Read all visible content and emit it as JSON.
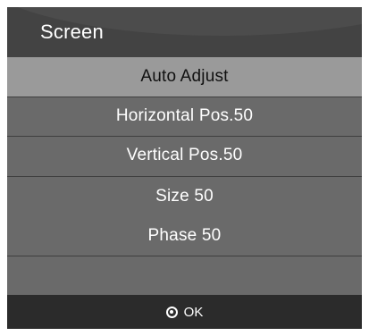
{
  "header": {
    "title": "Screen"
  },
  "menu": {
    "items": [
      {
        "label": "Auto Adjust"
      },
      {
        "label": "Horizontal Pos.50"
      },
      {
        "label": "Vertical Pos.50"
      },
      {
        "label": "Size 50"
      },
      {
        "label": "Phase 50"
      }
    ],
    "selected": "Auto Adjust"
  },
  "footer": {
    "ok_label": "OK",
    "ok_icon": "ok-button-icon"
  },
  "colors": {
    "panel": "#3d3d3d",
    "menu_bg": "#6a6a6a",
    "selected_bg": "#9a9a9a",
    "footer_bg": "#2b2b2b",
    "text": "#ffffff"
  }
}
